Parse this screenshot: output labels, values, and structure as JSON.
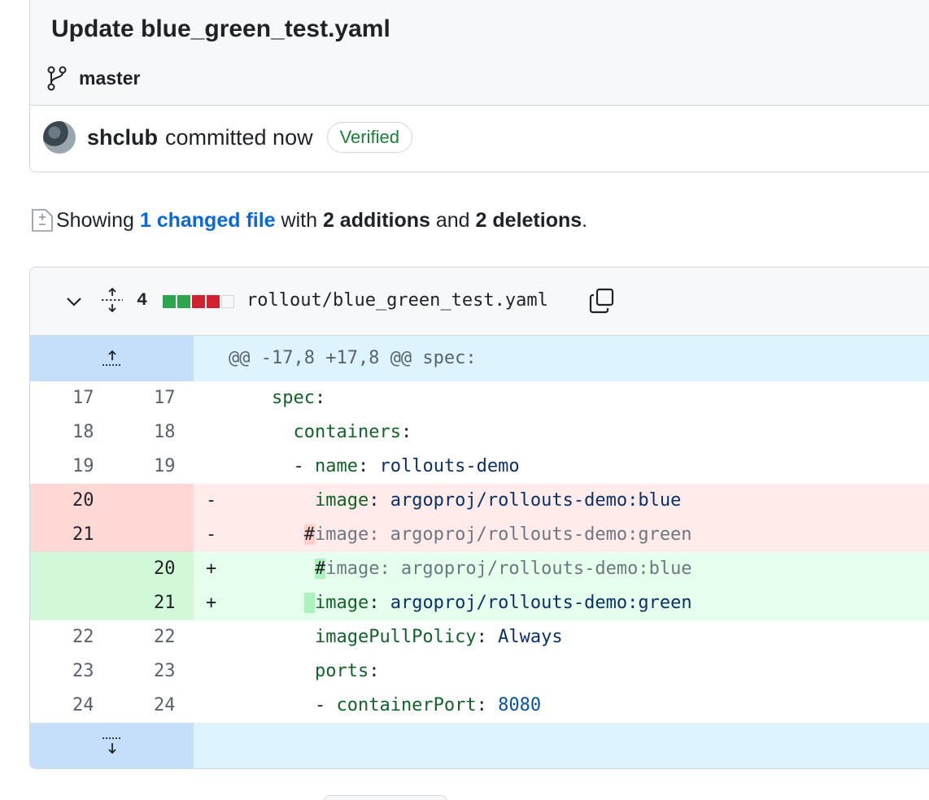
{
  "commit": {
    "title": "Update blue_green_test.yaml",
    "branch": "master",
    "author": "shclub",
    "time": "committed now",
    "verified": "Verified"
  },
  "summary": {
    "prefix": "Showing ",
    "changed_files": "1 changed file",
    "with": " with ",
    "additions": "2 additions",
    "and": " and ",
    "deletions": "2 deletions",
    "suffix": "."
  },
  "file": {
    "change_count": "4",
    "diffstat": [
      "#2da44e",
      "#2da44e",
      "#cf222e",
      "#cf222e",
      "#eaeef2"
    ],
    "path": "rollout/blue_green_test.yaml"
  },
  "diff": {
    "hunk_header": "@@ -17,8 +17,8 @@ spec:",
    "lines": [
      {
        "type": "ctx",
        "old": "17",
        "new": "17",
        "sign": "",
        "indent": "    ",
        "parts": [
          {
            "t": "spec",
            "c": "k"
          },
          {
            "t": ":",
            "c": ""
          }
        ]
      },
      {
        "type": "ctx",
        "old": "18",
        "new": "18",
        "sign": "",
        "indent": "      ",
        "parts": [
          {
            "t": "containers",
            "c": "k"
          },
          {
            "t": ":",
            "c": ""
          }
        ]
      },
      {
        "type": "ctx",
        "old": "19",
        "new": "19",
        "sign": "",
        "indent": "      ",
        "parts": [
          {
            "t": "- ",
            "c": ""
          },
          {
            "t": "name",
            "c": "k"
          },
          {
            "t": ": ",
            "c": ""
          },
          {
            "t": "rollouts-demo",
            "c": "s"
          }
        ]
      },
      {
        "type": "del",
        "old": "20",
        "new": "",
        "sign": "-",
        "indent": "        ",
        "parts": [
          {
            "t": "image",
            "c": "k"
          },
          {
            "t": ": ",
            "c": ""
          },
          {
            "t": "argoproj/rollouts-demo:blue",
            "c": "s"
          }
        ]
      },
      {
        "type": "del",
        "old": "21",
        "new": "",
        "sign": "-",
        "indent": "       ",
        "parts": [
          {
            "t": "#",
            "c": "hl-del"
          },
          {
            "t": "image: argoproj/rollouts-demo:green",
            "c": "c"
          }
        ]
      },
      {
        "type": "add",
        "old": "",
        "new": "20",
        "sign": "+",
        "indent": "        ",
        "parts": [
          {
            "t": "#",
            "c": "hl-add"
          },
          {
            "t": "image: argoproj/rollouts-demo:blue",
            "c": "c"
          }
        ]
      },
      {
        "type": "add",
        "old": "",
        "new": "21",
        "sign": "+",
        "indent": "       ",
        "parts": [
          {
            "t": " ",
            "c": "hl-add"
          },
          {
            "t": "image",
            "c": "k"
          },
          {
            "t": ": ",
            "c": ""
          },
          {
            "t": "argoproj/rollouts-demo:green",
            "c": "s"
          }
        ]
      },
      {
        "type": "ctx",
        "old": "22",
        "new": "22",
        "sign": "",
        "indent": "        ",
        "parts": [
          {
            "t": "imagePullPolicy",
            "c": "k"
          },
          {
            "t": ": ",
            "c": ""
          },
          {
            "t": "Always",
            "c": "s"
          }
        ]
      },
      {
        "type": "ctx",
        "old": "23",
        "new": "23",
        "sign": "",
        "indent": "        ",
        "parts": [
          {
            "t": "ports",
            "c": "k"
          },
          {
            "t": ":",
            "c": ""
          }
        ]
      },
      {
        "type": "ctx",
        "old": "24",
        "new": "24",
        "sign": "",
        "indent": "        ",
        "parts": [
          {
            "t": "- ",
            "c": ""
          },
          {
            "t": "containerPort",
            "c": "k"
          },
          {
            "t": ": ",
            "c": ""
          },
          {
            "t": "8080",
            "c": "n"
          }
        ]
      }
    ]
  }
}
